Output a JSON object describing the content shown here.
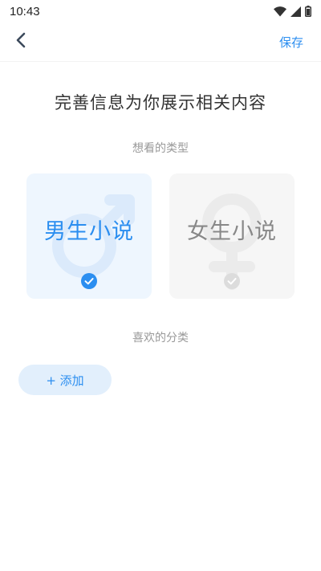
{
  "status_bar": {
    "time": "10:43"
  },
  "nav": {
    "save_label": "保存"
  },
  "title": "完善信息为你展示相关内容",
  "sections": {
    "type_label": "想看的类型",
    "category_label": "喜欢的分类"
  },
  "type_options": [
    {
      "label": "男生小说",
      "selected": true,
      "icon": "male-symbol"
    },
    {
      "label": "女生小说",
      "selected": false,
      "icon": "female-symbol"
    }
  ],
  "add_button": {
    "label": "+ 添加"
  },
  "colors": {
    "accent": "#2b8ef0",
    "male_card_bg": "#eef6fe",
    "female_card_bg": "#f6f6f6",
    "add_button_bg": "#e2effc"
  }
}
